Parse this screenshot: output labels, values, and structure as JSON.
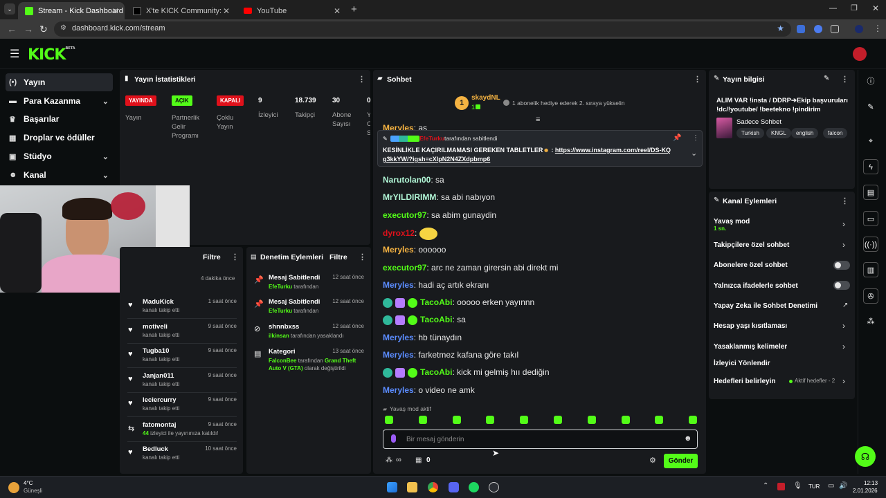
{
  "browser": {
    "tabs": [
      {
        "label": "Stream - Kick Dashboard",
        "active": true,
        "color": "#53fc18"
      },
      {
        "label": "X'te KICK Community: \"new bo",
        "active": false,
        "color": "#000000"
      },
      {
        "label": "YouTube",
        "active": false,
        "color": "#ff0000"
      }
    ],
    "url": "dashboard.kick.com/stream"
  },
  "header": {
    "logo": "KICK",
    "logo_tag": "BETA"
  },
  "sidebar": {
    "items": [
      {
        "label": "Yayın",
        "icon": "broadcast-icon",
        "active": true
      },
      {
        "label": "Para Kazanma",
        "icon": "money-icon",
        "chevron": true
      },
      {
        "label": "Başarılar",
        "icon": "trophy-icon"
      },
      {
        "label": "Droplar ve ödüller",
        "icon": "gift-icon"
      },
      {
        "label": "Stüdyo",
        "icon": "studio-icon",
        "chevron": true
      },
      {
        "label": "Kanal",
        "icon": "channel-icon",
        "chevron": true
      }
    ]
  },
  "stats": {
    "title": "Yayın İstatistikleri",
    "badges": [
      {
        "label": "YAYINDA",
        "caption": "Yayın",
        "color": "#e0111b",
        "text_color": "#ffffff"
      },
      {
        "label": "AÇIK",
        "caption": "Partnerlik Gelir Programı",
        "color": "#53fc18",
        "text_color": "#0b0e0f"
      },
      {
        "label": "KAPALI",
        "caption": "Çoklu Yayın",
        "color": "#e0111b",
        "text_color": "#ffffff"
      }
    ],
    "values": [
      {
        "value": "9",
        "label": "İzleyici"
      },
      {
        "value": "18.739",
        "label": "Takipçi"
      },
      {
        "value": "30",
        "label": "Abone Sayısı"
      },
      {
        "value": "0",
        "label": "Y O S"
      }
    ]
  },
  "activity": {
    "filter": "Filtre",
    "first_time": "4 dakika önce",
    "rows": [
      {
        "name": "MaduKick",
        "sub": "kanalı takip etti",
        "time": "1 saat önce",
        "icon": "heart-icon"
      },
      {
        "name": "motiveli",
        "sub": "kanalı takip etti",
        "time": "9 saat önce",
        "icon": "heart-icon"
      },
      {
        "name": "Tugba10",
        "sub": "kanalı takip etti",
        "time": "9 saat önce",
        "icon": "heart-icon"
      },
      {
        "name": "Janjan011",
        "sub": "kanalı takip etti",
        "time": "9 saat önce",
        "icon": "heart-icon"
      },
      {
        "name": "leciercurry",
        "sub": "kanalı takip etti",
        "time": "9 saat önce",
        "icon": "heart-icon"
      },
      {
        "name": "fatomontaj",
        "sub_strong": "44",
        "sub": " izleyici ile yayınınıza katıldı!",
        "time": "9 saat önce",
        "icon": "raid-icon"
      },
      {
        "name": "Bedluck",
        "sub": "kanalı takip etti",
        "time": "10 saat önce",
        "icon": "heart-icon"
      }
    ]
  },
  "mod": {
    "title": "Denetim Eylemleri",
    "filter": "Filtre",
    "rows": [
      {
        "name": "Mesaj Sabitlendi",
        "actor": "EfeTurku",
        "rest": " tarafından",
        "time": "12 saat önce",
        "icon": "pin-icon"
      },
      {
        "name": "Mesaj Sabitlendi",
        "actor": "EfeTurku",
        "rest": " tarafından",
        "time": "12 saat önce",
        "icon": "pin-icon"
      },
      {
        "name": "shnnbxss",
        "actor": "ilkinsan",
        "rest": " tarafından yasaklandı",
        "time": "12 saat önce",
        "icon": "ban-icon"
      },
      {
        "name": "Kategori",
        "actor": "FalconBee",
        "rest": " tarafından ",
        "actor2": "Grand Theft Auto V (GTA)",
        "rest2": " olarak değiştirildi",
        "time": "13 saat önce",
        "icon": "category-icon"
      }
    ]
  },
  "chat": {
    "title": "Sohbet",
    "top_gifter": {
      "name": "skaydNL",
      "rank": "1",
      "count": "1",
      "cta": "1 abonelik hediye ederek 2. sıraya yükselin"
    },
    "pinned": {
      "pinned_by": "EfeTurku",
      "pinned_label": "tarafından sabitlendi",
      "user": "Meryles",
      "user_msg": "as",
      "text": "KESİNLİKLE KAÇIRILMAMASI GEREKEN TABLETLER",
      "link": "https://www.instagram.com/reel/DS-KQg3kkYW/?igsh=cXlpN2N4ZXdpbmp6"
    },
    "messages": [
      {
        "user": "Narutolan00",
        "color": "#b1f6d6",
        "text": "sa"
      },
      {
        "user": "MrYILDIRIMM",
        "color": "#b1f6d6",
        "text": "sa abi nabıyon"
      },
      {
        "user": "executor97",
        "color": "#53fc18",
        "text": "sa abim gunaydin"
      },
      {
        "user": "dyrox12",
        "color": "#e0111b",
        "text": ""
      },
      {
        "user": "Meryles",
        "color": "#f5b342",
        "text": "oooooo"
      },
      {
        "user": "executor97",
        "color": "#53fc18",
        "text": "arc ne zaman girersin abi direkt mi"
      },
      {
        "user": "Meryles",
        "color": "#5b8cff",
        "text": "hadi aç artık ekranı"
      },
      {
        "user": "TacoAbi",
        "color": "#53fc18",
        "text": "ooooo erken yayınnn",
        "badges": true
      },
      {
        "user": "TacoAbi",
        "color": "#53fc18",
        "text": "sa",
        "badges": true
      },
      {
        "user": "Meryles",
        "color": "#5b8cff",
        "text": "hb tünaydın"
      },
      {
        "user": "Meryles",
        "color": "#5b8cff",
        "text": "farketmez kafana göre takıl"
      },
      {
        "user": "TacoAbi",
        "color": "#53fc18",
        "text": "kick mi gelmiş hıı dediğin",
        "badges": true
      },
      {
        "user": "Meryles",
        "color": "#5b8cff",
        "text": "o video ne amk"
      }
    ],
    "slow_mode": "Yavaş mod aktif",
    "input_placeholder": "Bir mesaj gönderin",
    "points": "∞",
    "gifts": "0",
    "send": "Gönder"
  },
  "info": {
    "title": "Yayın bilgisi",
    "stream_title": "ALIM VAR !insta / DDRP➔Ekip başvuruları !dc/!youtube/ !beetekno !pindirim",
    "category": "Sadece Sohbet",
    "tags": [
      "Turkish",
      "KNGL",
      "english",
      "falcon"
    ]
  },
  "channel_actions": {
    "title": "Kanal Eylemleri",
    "slow_mode": {
      "label": "Yavaş mod",
      "value": "1 sn."
    },
    "followers_only": "Takipçilere özel sohbet",
    "subs_only": "Abonelere özel sohbet",
    "emotes_only": "Yalnızca ifadelerle sohbet",
    "ai_moderation": "Yapay Zeka ile Sohbet Denetimi",
    "age_restriction": "Hesap yaşı kısıtlaması",
    "banned_words": "Yasaklanmış kelimeler",
    "redirect": "İzleyici Yönlendir",
    "goals": "Hedefleri belirleyin",
    "goals_status": "Aktif hedefler - 2"
  },
  "taskbar": {
    "weather_temp": "4°C",
    "weather_text": "Güneşli",
    "lang": "TUR",
    "time": "12:13",
    "date": "2.01.2026"
  }
}
